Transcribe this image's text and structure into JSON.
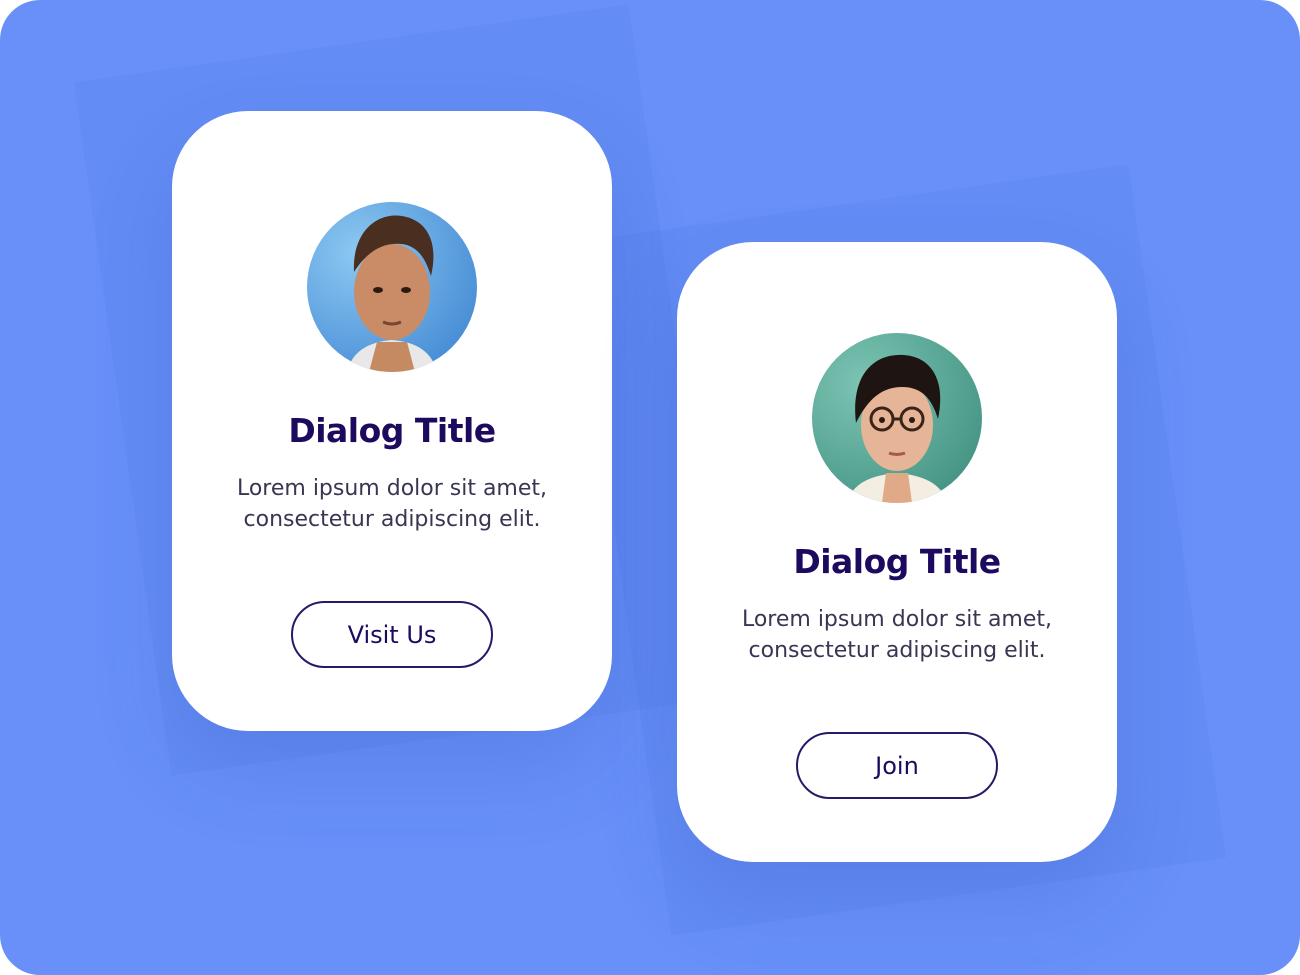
{
  "cards": [
    {
      "title": "Dialog Title",
      "body_line1": "Lorem ipsum dolor sit amet,",
      "body_line2": "consectetur adipiscing elit.",
      "button_label": "Visit Us",
      "avatar_bg": "#5aa0e6"
    },
    {
      "title": "Dialog Title",
      "body_line1": "Lorem ipsum dolor sit amet,",
      "body_line2": "consectetur adipiscing elit.",
      "button_label": "Join",
      "avatar_bg": "#5ea898"
    }
  ],
  "colors": {
    "background": "#6890f8",
    "card": "#ffffff",
    "title": "#1d0a5f",
    "button_border": "#2a1866"
  }
}
